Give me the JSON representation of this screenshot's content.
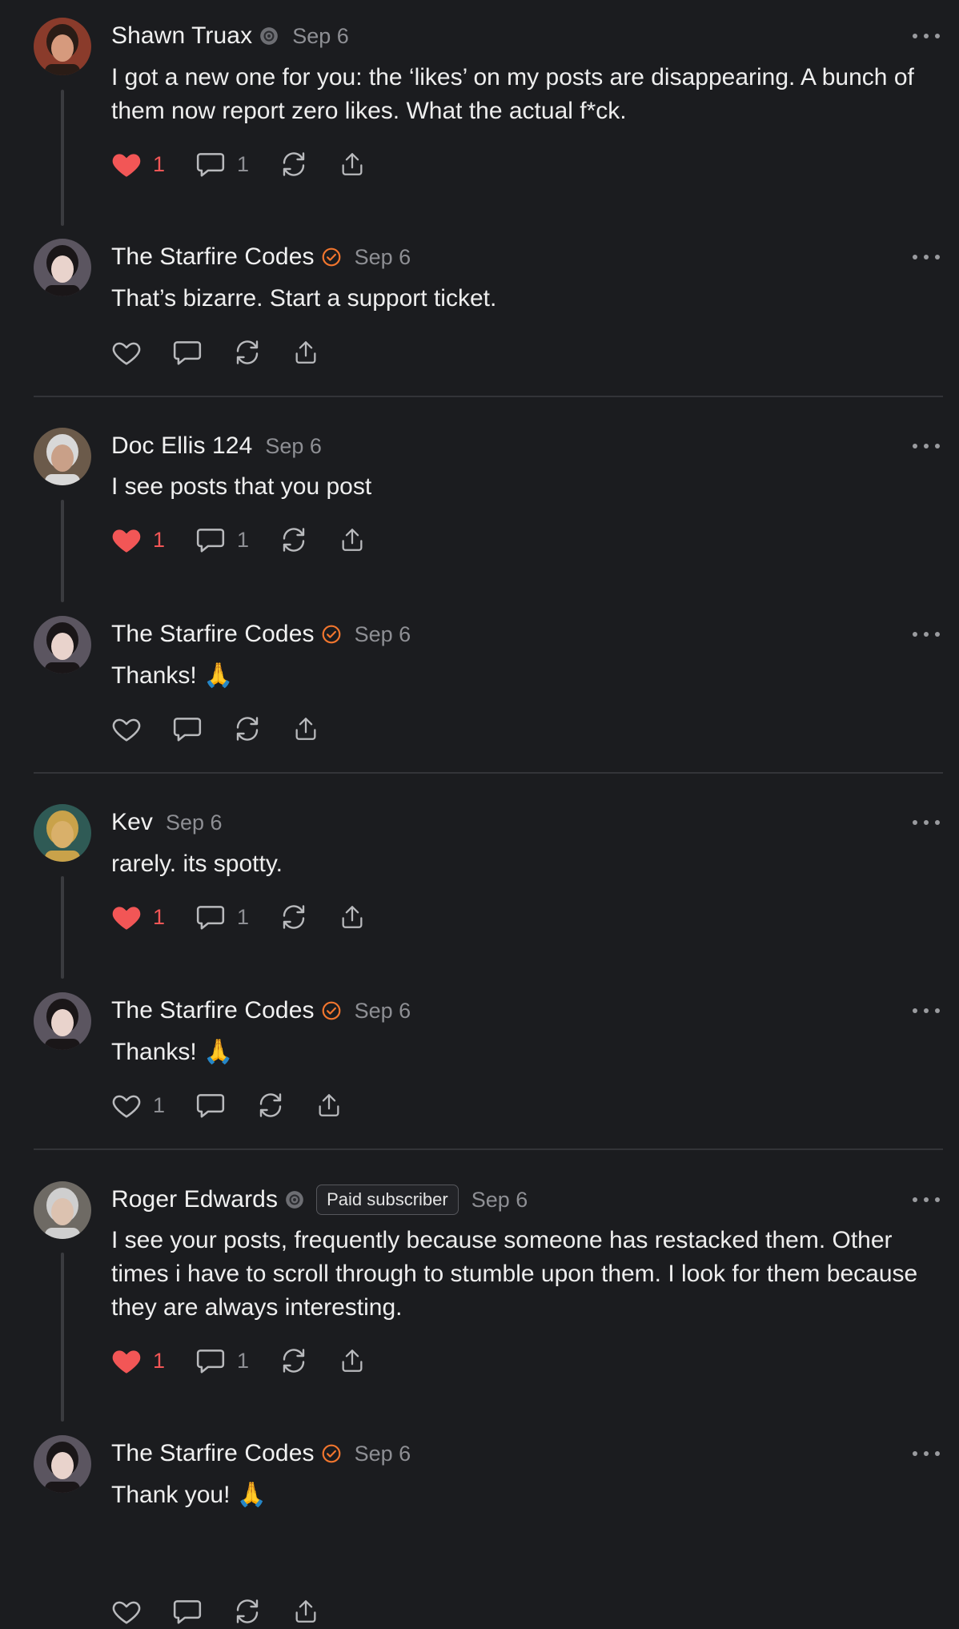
{
  "comments": [
    {
      "author": "Shawn Truax",
      "badge": "gear-badge-icon",
      "date": "Sep 6",
      "text": "I got a new one for you: the ‘likes’ on my posts are disappearing. A bunch of them now report zero likes. What the actual f*ck.",
      "liked": true,
      "likes": "1",
      "replies": "1",
      "avatar_color": "#8a3b2b"
    },
    {
      "author": "The Starfire Codes",
      "badge": "verified-check-icon",
      "date": "Sep 6",
      "text": "That’s bizarre. Start a support ticket.",
      "liked": false,
      "likes": "",
      "replies": "",
      "avatar_color": "#5b5560"
    },
    {
      "author": "Doc Ellis 124",
      "badge": "",
      "date": "Sep 6",
      "text": "I see posts that you post",
      "liked": true,
      "likes": "1",
      "replies": "1",
      "avatar_color": "#6b5a4a"
    },
    {
      "author": "The Starfire Codes",
      "badge": "verified-check-icon",
      "date": "Sep 6",
      "text": "Thanks! 🙏",
      "liked": false,
      "likes": "",
      "replies": "",
      "avatar_color": "#5b5560"
    },
    {
      "author": "Kev",
      "badge": "",
      "date": "Sep 6",
      "text": "rarely. its spotty.",
      "liked": true,
      "likes": "1",
      "replies": "1",
      "avatar_color": "#2f5a55"
    },
    {
      "author": "The Starfire Codes",
      "badge": "verified-check-icon",
      "date": "Sep 6",
      "text": "Thanks! 🙏",
      "liked": false,
      "likes": "1",
      "replies": "",
      "avatar_color": "#5b5560"
    },
    {
      "author": "Roger Edwards",
      "badge": "gear-badge-icon",
      "pill": "Paid subscriber",
      "date": "Sep 6",
      "text": "I see your posts, frequently because someone has restacked them. Other times i have to scroll through to stumble upon them. I look for them because they are always interesting.",
      "liked": true,
      "likes": "1",
      "replies": "1",
      "avatar_color": "#6e6a64"
    },
    {
      "author": "The Starfire Codes",
      "badge": "verified-check-icon",
      "date": "Sep 6",
      "text": "Thank you! 🙏",
      "liked": false,
      "likes": "",
      "replies": "",
      "avatar_color": "#5b5560"
    }
  ],
  "colors": {
    "background": "#1b1c1f",
    "like_red": "#f25656",
    "verified_orange": "#f2762e",
    "muted": "#8e8f94"
  }
}
